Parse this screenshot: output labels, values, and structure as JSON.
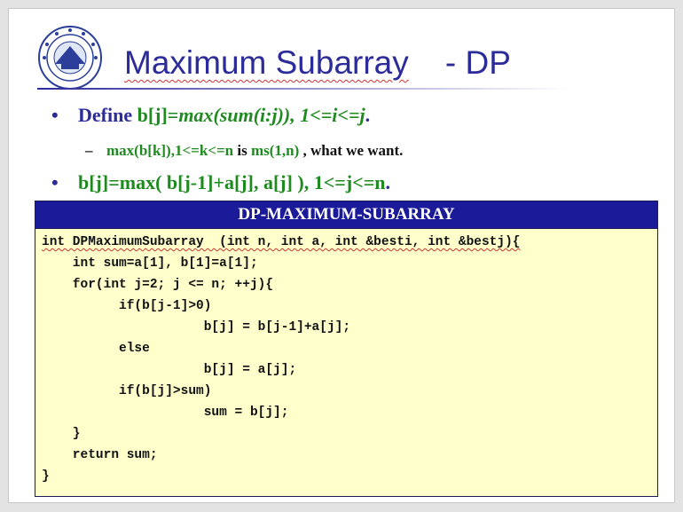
{
  "slide": {
    "title_main": "Maximum Subarray",
    "title_suffix": "- DP",
    "logo_icon": "university-seal-icon",
    "bullet1": {
      "define": "Define",
      "lhs": "b[j]=",
      "expr": "max(sum(i:j)), 1<=i<=j",
      "period": "."
    },
    "sub_bullet": {
      "part1": "max(b[k]),1<=k<=n",
      "part2": " is ",
      "part3": "ms(1,n)",
      "part4": " , what we want."
    },
    "bullet2": {
      "formula": "b[j]=max( b[j-1]+a[j], a[j] ), 1<=j<=n",
      "period": "."
    }
  },
  "code": {
    "header": "DP-MAXIMUM-SUBARRAY",
    "lines": [
      "int DPMaximumSubarray  (int n, int a, int &besti, int &bestj){",
      "    int sum=a[1], b[1]=a[1];",
      "    for(int j=2; j <= n; ++j){",
      "          if(b[j-1]>0)",
      "                     b[j] = b[j-1]+a[j];",
      "          else",
      "                     b[j] = a[j];",
      "          if(b[j]>sum)",
      "                     sum = b[j];",
      "    }",
      "    return sum;",
      "}"
    ]
  },
  "colors": {
    "title_blue": "#2b2b9a",
    "bullet_green": "#1f8a1f",
    "code_header_bg": "#1b1b9a",
    "code_bg": "#ffffcc"
  }
}
